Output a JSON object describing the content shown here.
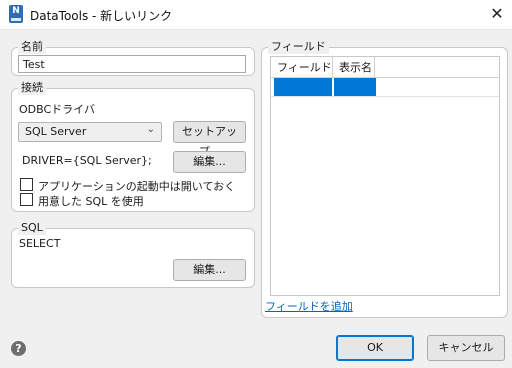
{
  "window": {
    "app_icon_letter": "N",
    "title": "DataTools - 新しいリンク",
    "close_glyph": "✕"
  },
  "name_group": {
    "legend": "名前",
    "value": "Test"
  },
  "connection_group": {
    "legend": "接続",
    "odbc_label": "ODBCドライバ",
    "driver_select": "SQL Server",
    "setup_button": "セットアップ...",
    "driver_string": "DRIVER={SQL Server};",
    "edit_button": "編集...",
    "checkbox_keep_open": {
      "label": "アプリケーションの起動中は開いておく",
      "checked": false
    },
    "checkbox_prepared_sql": {
      "label": "用意した SQL を使用",
      "checked": false
    }
  },
  "sql_group": {
    "legend": "SQL",
    "query": "SELECT",
    "edit_button": "編集..."
  },
  "fields_group": {
    "legend": "フィールド",
    "columns": [
      "フィールド名",
      "表示名"
    ],
    "add_field_link": "フィールドを追加"
  },
  "footer": {
    "help_glyph": "?",
    "ok_button": "OK",
    "cancel_button": "キャンセル"
  },
  "colors": {
    "selection": "#0078d7",
    "link": "#0563c1"
  }
}
